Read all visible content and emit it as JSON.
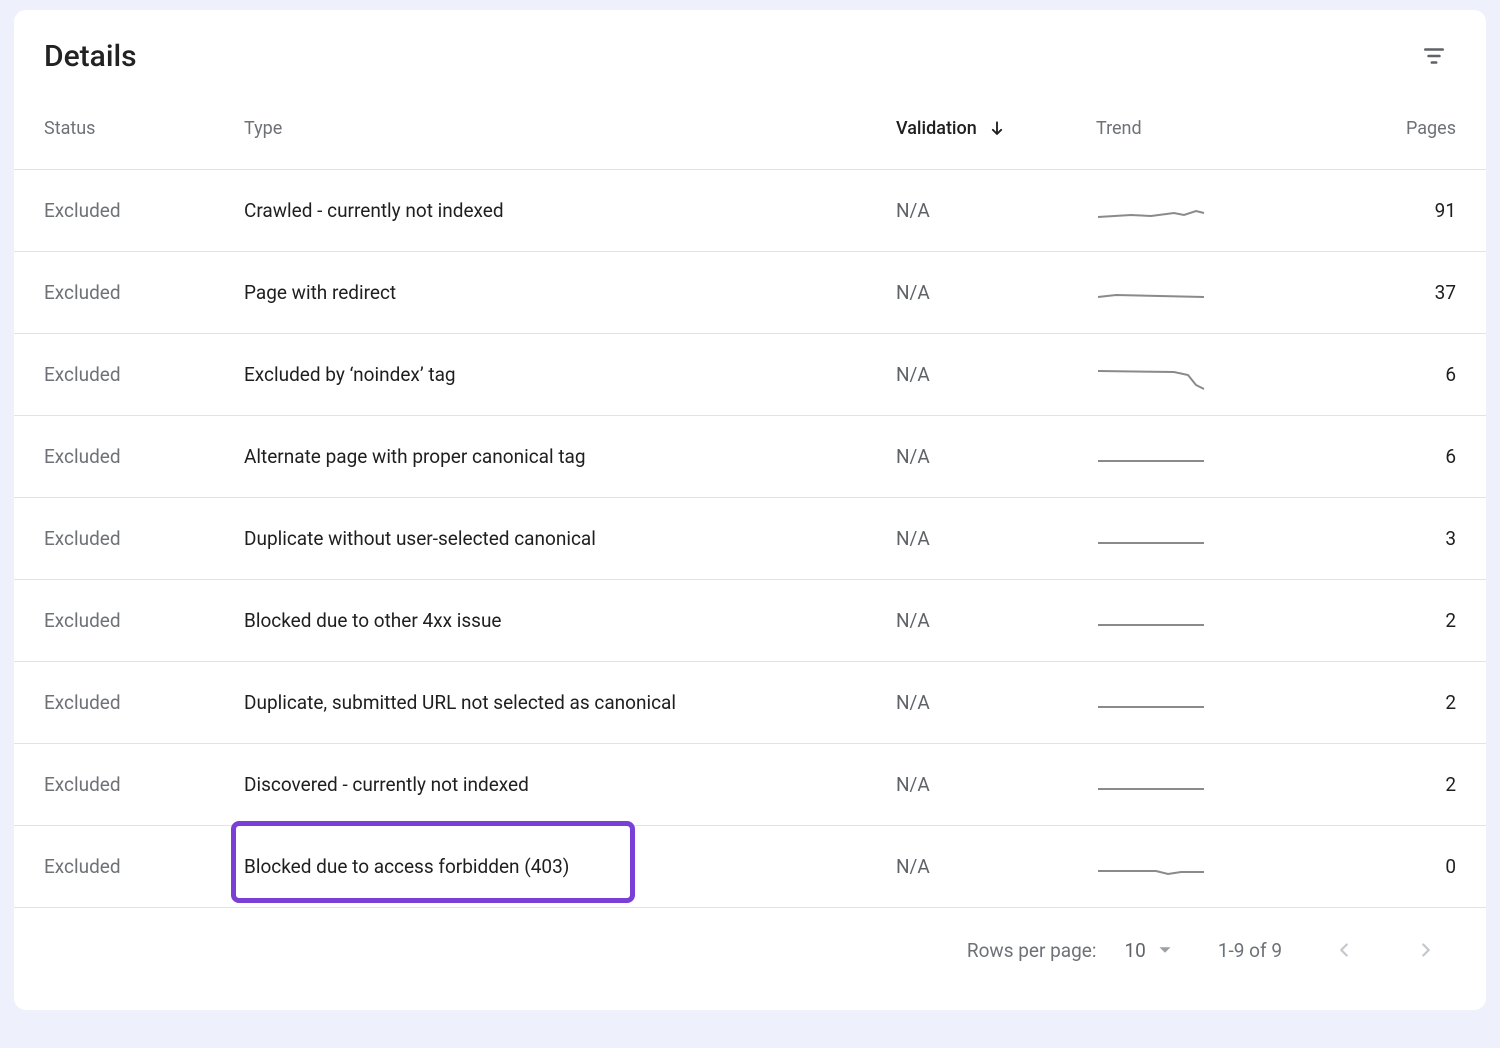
{
  "title": "Details",
  "columns": {
    "status": "Status",
    "type": "Type",
    "validation": "Validation",
    "trend": "Trend",
    "pages": "Pages"
  },
  "rows": [
    {
      "status": "Excluded",
      "type": "Crawled - currently not indexed",
      "validation": "N/A",
      "trend": "wavy-up",
      "pages": "91"
    },
    {
      "status": "Excluded",
      "type": "Page with redirect",
      "validation": "N/A",
      "trend": "flat-slight",
      "pages": "37"
    },
    {
      "status": "Excluded",
      "type": "Excluded by ‘noindex’ tag",
      "validation": "N/A",
      "trend": "drop-end",
      "pages": "6"
    },
    {
      "status": "Excluded",
      "type": "Alternate page with proper canonical tag",
      "validation": "N/A",
      "trend": "flat",
      "pages": "6"
    },
    {
      "status": "Excluded",
      "type": "Duplicate without user-selected canonical",
      "validation": "N/A",
      "trend": "flat",
      "pages": "3"
    },
    {
      "status": "Excluded",
      "type": "Blocked due to other 4xx issue",
      "validation": "N/A",
      "trend": "flat",
      "pages": "2"
    },
    {
      "status": "Excluded",
      "type": "Duplicate, submitted URL not selected as canonical",
      "validation": "N/A",
      "trend": "flat",
      "pages": "2"
    },
    {
      "status": "Excluded",
      "type": "Discovered - currently not indexed",
      "validation": "N/A",
      "trend": "flat",
      "pages": "2"
    },
    {
      "status": "Excluded",
      "type": "Blocked due to access forbidden (403)",
      "validation": "N/A",
      "trend": "flat-dip",
      "pages": "0"
    }
  ],
  "highlight_row_index": 8,
  "footer": {
    "rows_per_page_label": "Rows per page:",
    "rows_per_page_value": "10",
    "range_text": "1-9 of 9"
  }
}
